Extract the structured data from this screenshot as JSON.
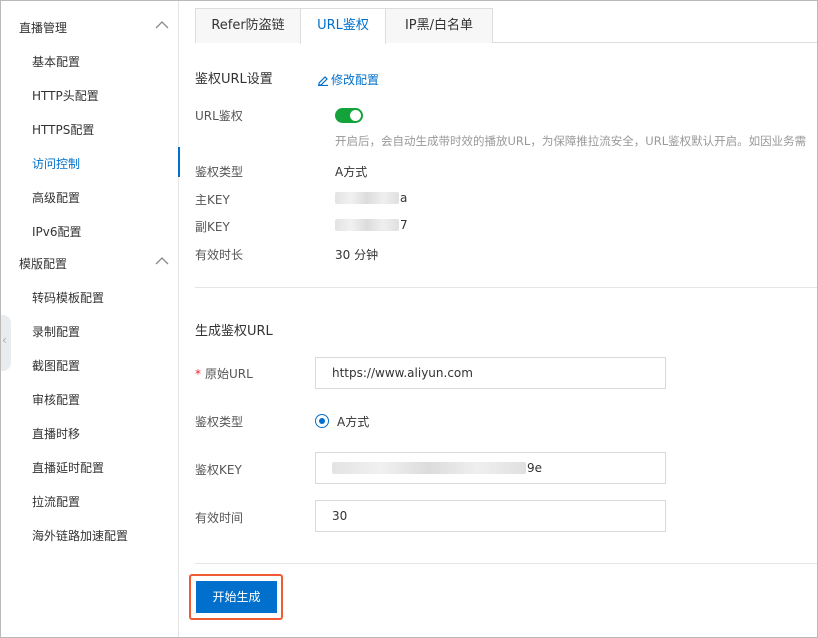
{
  "sidebar": {
    "groups": [
      {
        "title": "直播管理",
        "items": [
          "基本配置",
          "HTTP头配置",
          "HTTPS配置",
          "访问控制",
          "高级配置",
          "IPv6配置"
        ]
      },
      {
        "title": "模版配置",
        "items": [
          "转码模板配置",
          "录制配置",
          "截图配置",
          "审核配置",
          "直播时移",
          "直播延时配置",
          "拉流配置",
          "海外链路加速配置"
        ]
      }
    ],
    "active_item": "访问控制"
  },
  "tabs": [
    {
      "label": "Refer防盗链"
    },
    {
      "label": "URL鉴权"
    },
    {
      "label": "IP黑/白名单"
    }
  ],
  "settings": {
    "title": "鉴权URL设置",
    "edit_label": "修改配置",
    "url_auth_label": "URL鉴权",
    "url_auth_enabled": true,
    "url_auth_desc": "开启后，会自动生成带时效的播放URL，为保障推拉流安全，URL鉴权默认开启。如因业务需",
    "auth_type_label": "鉴权类型",
    "auth_type_value": "A方式",
    "primary_key_label": "主KEY",
    "primary_key_suffix": "a",
    "secondary_key_label": "副KEY",
    "secondary_key_suffix": "7",
    "validity_label": "有效时长",
    "validity_value": "30 分钟"
  },
  "generator": {
    "title": "生成鉴权URL",
    "original_url_label": "原始URL",
    "original_url_value": "https://www.aliyun.com",
    "auth_type_label": "鉴权类型",
    "auth_type_option": "A方式",
    "auth_key_label": "鉴权KEY",
    "auth_key_suffix": "9e",
    "valid_time_label": "有效时间",
    "valid_time_value": "30",
    "generate_button": "开始生成"
  },
  "colors": {
    "accent": "#0070cc",
    "toggle_on": "#13a33a",
    "highlight": "#f05a35"
  }
}
